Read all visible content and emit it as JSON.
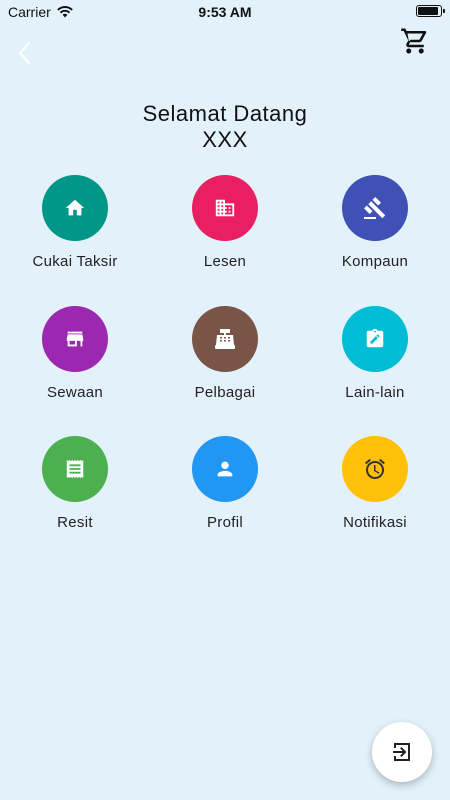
{
  "status_bar": {
    "carrier": "Carrier",
    "time": "9:53 AM",
    "battery_level": 0.9
  },
  "header": {
    "back_icon": "chevron-left-icon",
    "cart_icon": "cart-icon"
  },
  "welcome": {
    "line1": "Selamat Datang",
    "line2": "XXX"
  },
  "menu": [
    {
      "label": "Cukai Taksir",
      "icon": "home-icon",
      "color": "#009688"
    },
    {
      "label": "Lesen",
      "icon": "building-icon",
      "color": "#e91e63"
    },
    {
      "label": "Kompaun",
      "icon": "gavel-icon",
      "color": "#3f51b5"
    },
    {
      "label": "Sewaan",
      "icon": "store-icon",
      "color": "#9c27b0"
    },
    {
      "label": "Pelbagai",
      "icon": "cash-register-icon",
      "color": "#795548"
    },
    {
      "label": "Lain-lain",
      "icon": "clipboard-edit-icon",
      "color": "#00bcd4"
    },
    {
      "label": "Resit",
      "icon": "receipt-icon",
      "color": "#4caf50"
    },
    {
      "label": "Profil",
      "icon": "person-icon",
      "color": "#2196f3"
    },
    {
      "label": "Notifikasi",
      "icon": "alarm-icon",
      "color": "#ffc107"
    }
  ],
  "fab": {
    "icon": "logout-icon"
  }
}
